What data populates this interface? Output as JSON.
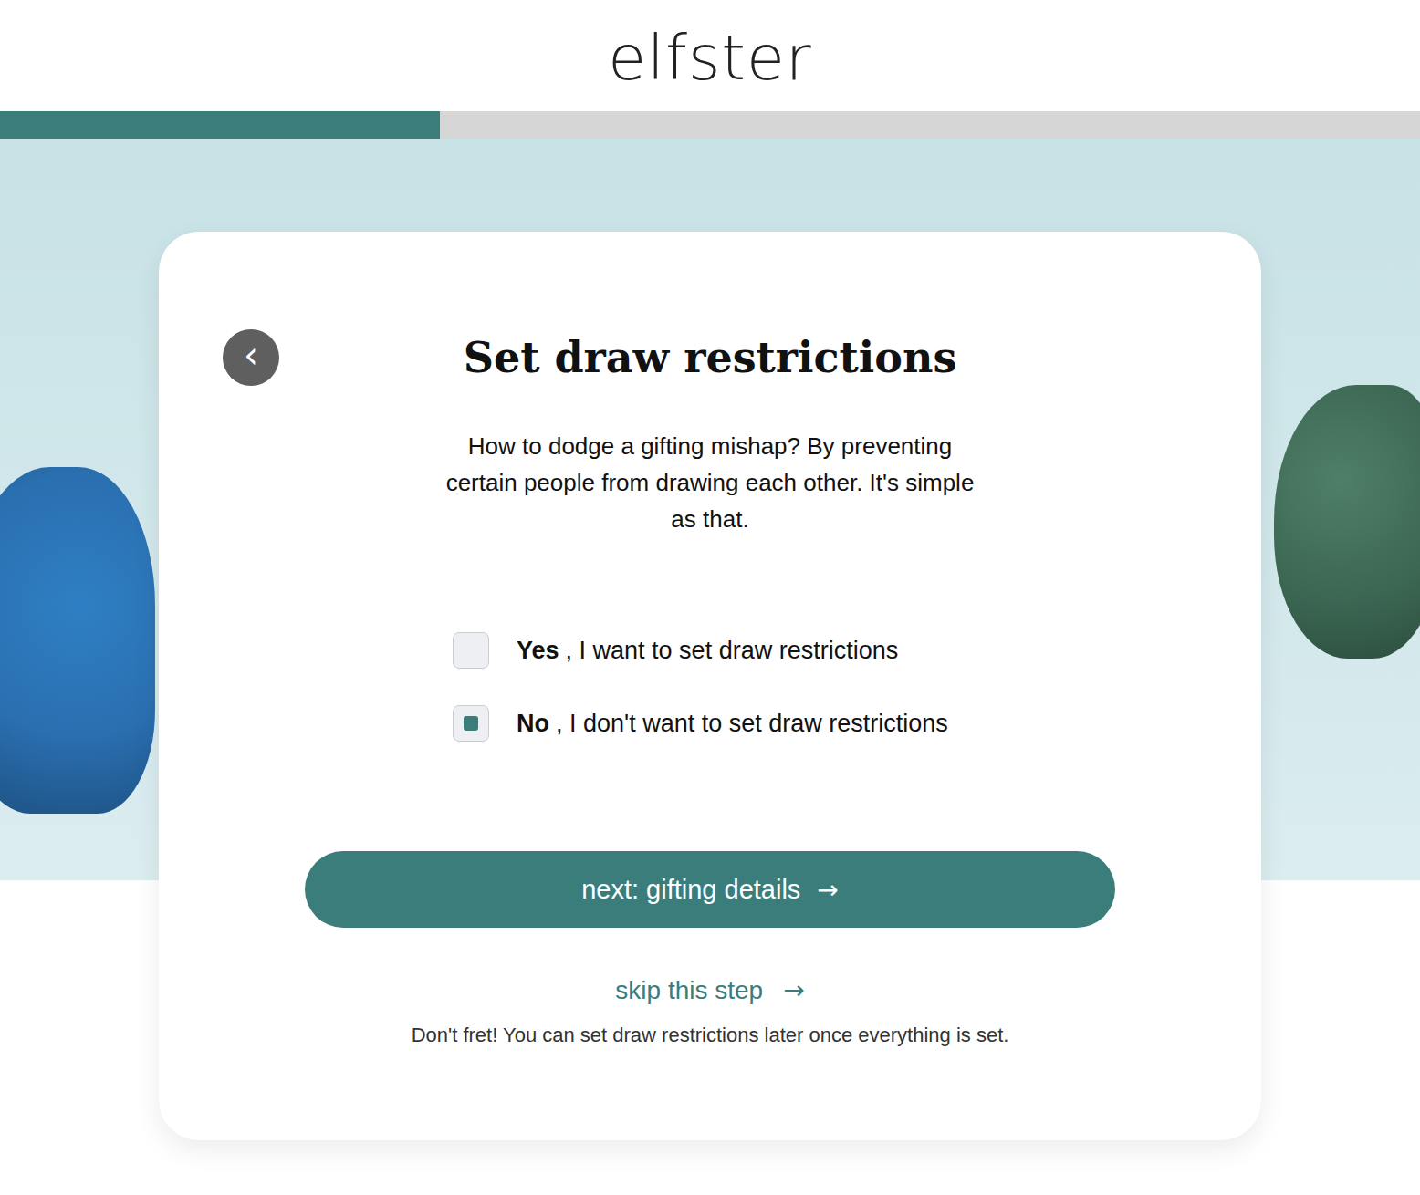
{
  "header": {
    "logo": "elfster"
  },
  "progress": {
    "level": 0.31
  },
  "card": {
    "back": {
      "label": "‹"
    },
    "title": "Set draw restrictions",
    "description": "How to dodge a gifting mishap? By preventing certain people from drawing each other. It's simple as that.",
    "options": [
      {
        "emphasis": "Yes",
        "label": ", I want to set draw restrictions",
        "selected": false
      },
      {
        "emphasis": "No",
        "label": ", I don't want to set draw restrictions",
        "selected": true
      }
    ],
    "next_button": {
      "label": "next: gifting details",
      "arrow": "→"
    },
    "skip": {
      "label": "skip this step",
      "arrow": "→"
    },
    "note": "Don't fret! You can set draw restrictions later once everything is set."
  }
}
